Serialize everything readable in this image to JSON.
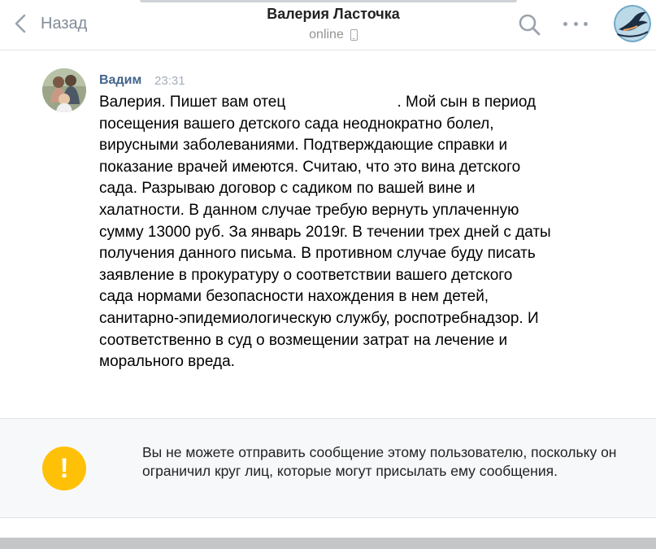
{
  "header": {
    "back_label": "Назад",
    "title": "Валерия Ласточка",
    "status": "online"
  },
  "message": {
    "author": "Вадим",
    "time": "23:31",
    "text": "Валерия. Пишет вам отец                          . Мой сын в период\nпосещения вашего детского сада неоднократно болел,\nвирусными заболеваниями. Подтверждающие справки и\nпоказание врачей имеются. Считаю, что это вина детского\nсада. Разрываю договор с садиком по вашей вине и\nхалатности. В данном случае требую вернуть уплаченную\nсумму 13000 руб. За январь 2019г. В течении трех дней с даты\nполучения данного письма. В противном случае буду писать\nзаявление в прокуратуру о соответствии вашего детского\nсада нормами безопасности нахождения в нем детей,\nсанитарно-эпидемиологическую службу, роспотребнадзор. И\nсоответственно в суд о возмещении затрат на лечение и\nморального вреда."
  },
  "notice": {
    "text": "Вы не можете отправить сообщение этому пользователю, поскольку он ограничил круг лиц, которые могут присылать ему сообщения.",
    "icon_glyph": "!"
  },
  "colors": {
    "author": "#42648b",
    "warning": "#ffc107",
    "muted": "#818c99"
  },
  "icons": [
    "chevron-left-icon",
    "phone-icon",
    "search-icon",
    "more-dots-icon",
    "warning-icon"
  ]
}
